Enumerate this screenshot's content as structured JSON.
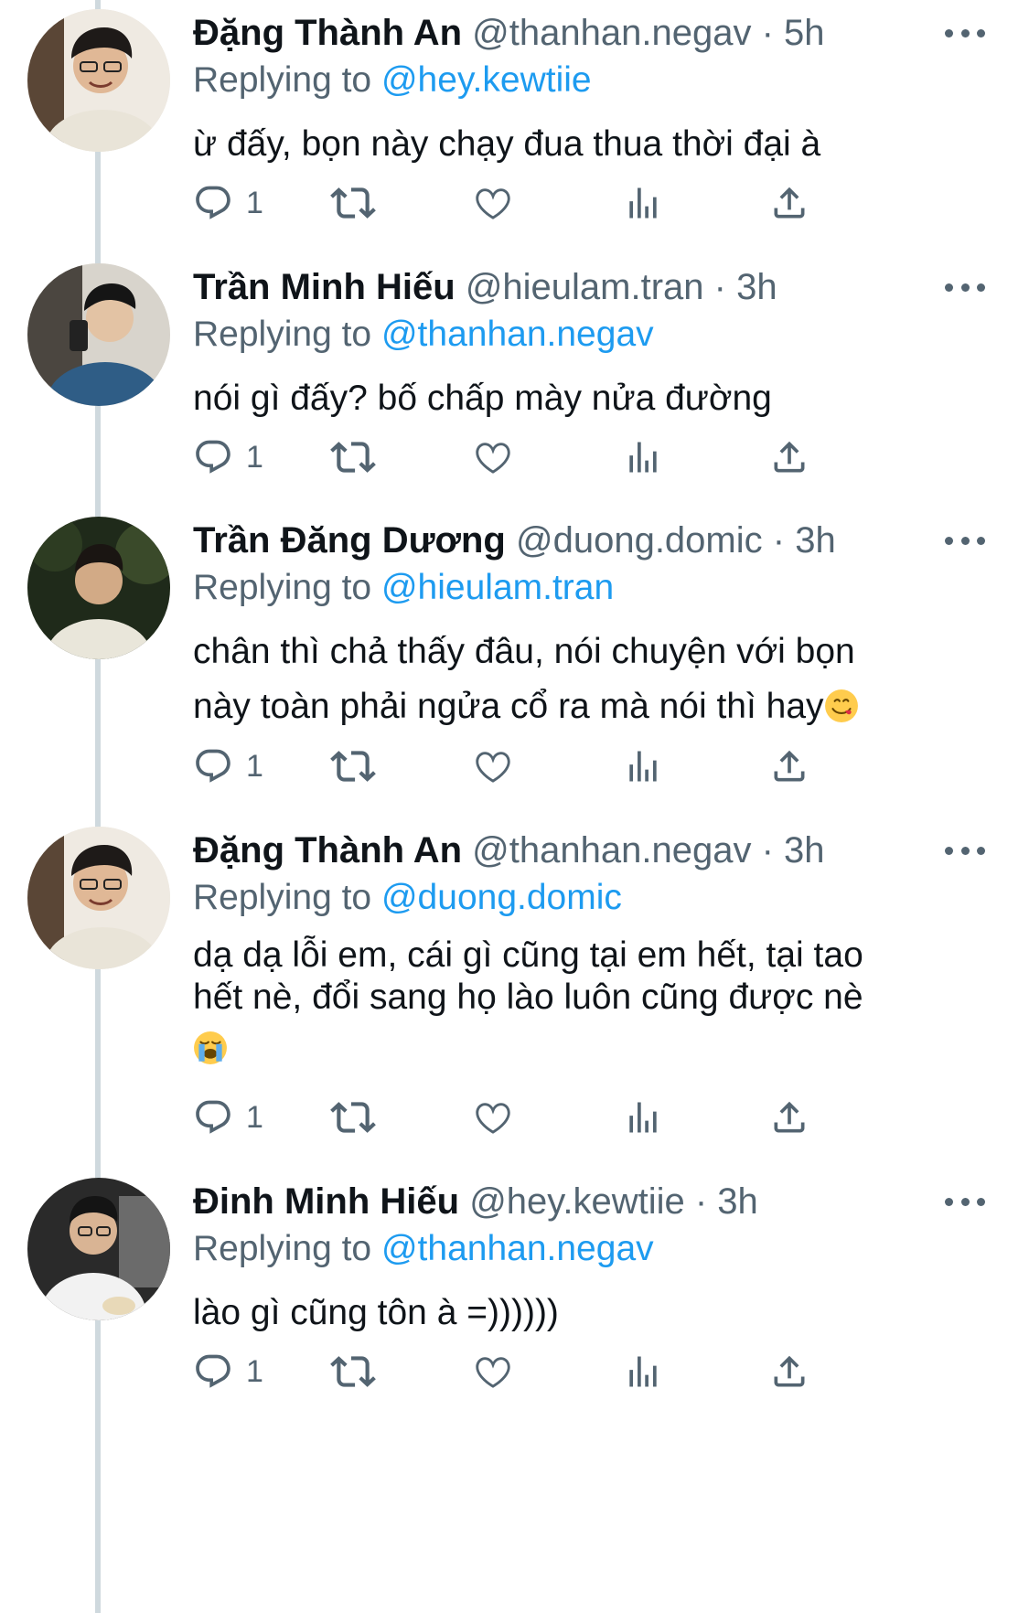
{
  "tweets": [
    {
      "name": "Đặng Thành An",
      "handle": "@thanhan.negav",
      "separator": "·",
      "time": "5h",
      "replying_label": "Replying to",
      "replying_to": "@hey.kewtiie",
      "text_lines": [
        "ừ đấy, bọn này chạy đua thua thời đại à"
      ],
      "reply_count": "1",
      "avatar_color": "#d9d3c8"
    },
    {
      "name": "Trần Minh Hiếu",
      "handle": "@hieulam.tran",
      "separator": "·",
      "time": "3h",
      "replying_label": "Replying to",
      "replying_to": "@thanhan.negav",
      "text_lines": [
        "nói gì đấy? bố chấp mày nửa đường"
      ],
      "reply_count": "1",
      "avatar_color": "#3a5a7a"
    },
    {
      "name": "Trần Đăng Dương",
      "handle": "@duong.domic",
      "separator": "·",
      "time": "3h",
      "replying_label": "Replying to",
      "replying_to": "@hieulam.tran",
      "text_lines": [
        "chân thì chả thấy đâu, nói chuyện với bọn",
        "này toàn phải ngửa cổ ra mà nói thì hay"
      ],
      "trailing_emoji": "yum-face-emoji",
      "reply_count": "1",
      "avatar_color": "#2f3a28"
    },
    {
      "name": "Đặng Thành An",
      "handle": "@thanhan.negav",
      "separator": "·",
      "time": "3h",
      "replying_label": "Replying to",
      "replying_to": "@duong.domic",
      "text_lines": [
        "dạ dạ lỗi em, cái gì cũng tại em hết, tại tao",
        "hết nè, đổi sang họ lào luôn cũng được nè"
      ],
      "trailing_emoji": "loudly-crying-face-emoji",
      "reply_count": "1",
      "avatar_color": "#d9d3c8"
    },
    {
      "name": "Đinh Minh Hiếu",
      "handle": "@hey.kewtiie",
      "separator": "·",
      "time": "3h",
      "replying_label": "Replying to",
      "replying_to": "@thanhan.negav",
      "text_lines": [
        "lào gì cũng tôn à =))))))"
      ],
      "reply_count": "1",
      "avatar_color": "#2c2c2c"
    }
  ],
  "icons": {
    "reply": "reply-icon",
    "retweet": "retweet-icon",
    "like": "like-icon",
    "views": "views-icon",
    "share": "share-icon",
    "more": "more-options-icon"
  },
  "colors": {
    "text_primary": "#0f1419",
    "text_secondary": "#536471",
    "link": "#1d9bf0",
    "thread_line": "#cfd9de"
  }
}
